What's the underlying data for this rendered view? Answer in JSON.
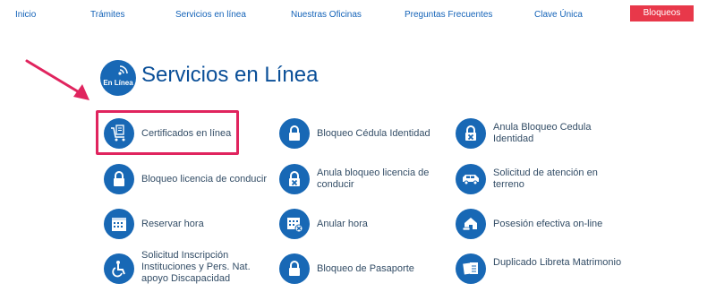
{
  "nav": {
    "inicio": "Inicio",
    "tramites": "Trámites",
    "servicios": "Servicios en línea",
    "oficinas": "Nuestras Oficinas",
    "preguntas": "Preguntas Frecuentes",
    "clave": "Clave Única",
    "bloqueos": "Bloqueos"
  },
  "header": {
    "badge_text": "En Línea",
    "title": "Servicios en Línea"
  },
  "services": {
    "certificados": "Certificados en línea",
    "bloqueo_cedula": "Bloqueo Cédula Identidad",
    "anula_bloqueo_cedula": "Anula Bloqueo Cedula Identidad",
    "bloqueo_licencia": "Bloqueo licencia de conducir",
    "anula_bloqueo_licencia": "Anula bloqueo licencia de conducir",
    "solicitud_atencion": "Solicitud de atención en terreno",
    "reservar_hora": "Reservar hora",
    "anular_hora": "Anular hora",
    "posesion_efectiva": "Posesión efectiva on-line",
    "solicitud_inscripcion": "Solicitud Inscripción Instituciones y Pers. Nat. apoyo Discapacidad",
    "bloqueo_pasaporte": "Bloqueo de Pasaporte",
    "duplicado_libreta": "Duplicado Libreta Matrimonio"
  },
  "colors": {
    "icon_bg": "#1868b5",
    "nav_link": "#1463b8",
    "bloqueos_bg": "#e8384a",
    "highlight": "#e0245e"
  },
  "icons": {
    "certificados": "cart-certificate-icon",
    "bloqueo": "padlock-icon",
    "anula_bloqueo": "unlock-x-icon",
    "atencion_terreno": "van-icon",
    "reservar_hora": "calendar-icon",
    "anular_hora": "calendar-x-icon",
    "posesion_efectiva": "house-car-icon",
    "discapacidad": "wheelchair-icon",
    "libreta": "booklet-icon"
  }
}
